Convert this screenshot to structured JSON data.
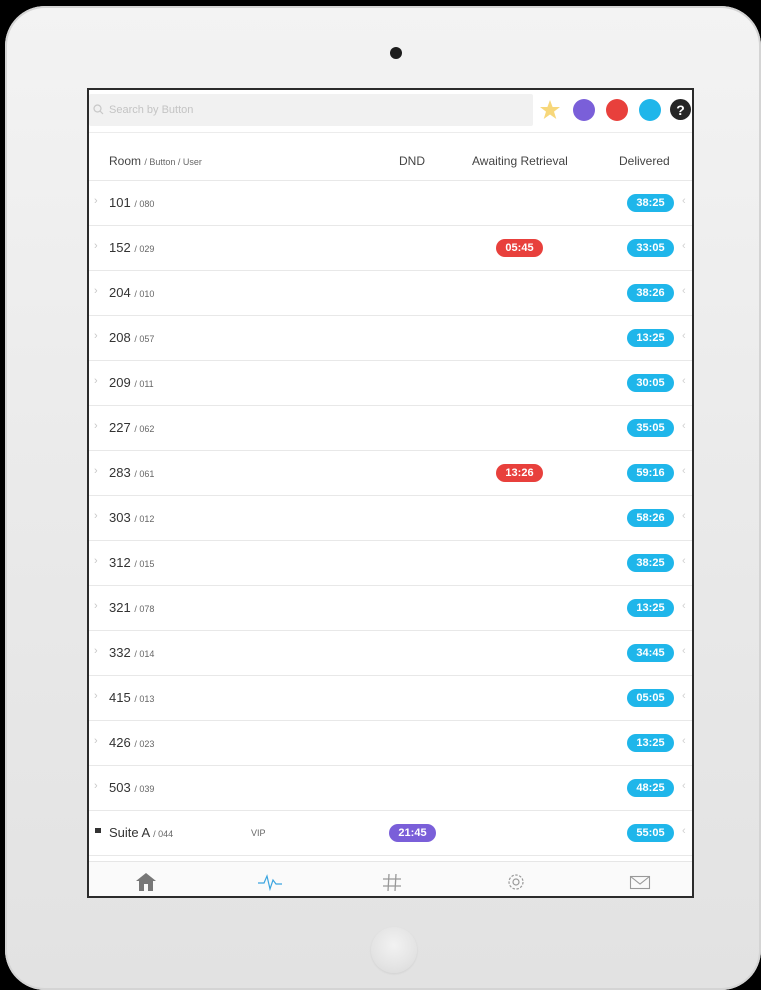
{
  "search": {
    "placeholder": "Search by Button"
  },
  "filters": {
    "colors": {
      "star": "#f7d77a",
      "purple": "#7a5fd9",
      "red": "#e8403c",
      "blue": "#1fb6ea"
    },
    "help_label": "?"
  },
  "columns": {
    "room": "Room",
    "room_sub": "/ Button / User",
    "dnd": "DND",
    "awaiting": "Awaiting Retrieval",
    "delivered": "Delivered"
  },
  "rows": [
    {
      "room": "101",
      "button": "/ 080",
      "delivered": "38:25"
    },
    {
      "room": "152",
      "button": "/ 029",
      "awaiting": "05:45",
      "delivered": "33:05"
    },
    {
      "room": "204",
      "button": "/ 010",
      "delivered": "38:26"
    },
    {
      "room": "208",
      "button": "/ 057",
      "delivered": "13:25"
    },
    {
      "room": "209",
      "button": "/ 011",
      "delivered": "30:05"
    },
    {
      "room": "227",
      "button": "/ 062",
      "delivered": "35:05"
    },
    {
      "room": "283",
      "button": "/ 061",
      "awaiting": "13:26",
      "delivered": "59:16"
    },
    {
      "room": "303",
      "button": "/ 012",
      "delivered": "58:26"
    },
    {
      "room": "312",
      "button": "/ 015",
      "delivered": "38:25"
    },
    {
      "room": "321",
      "button": "/ 078",
      "delivered": "13:25"
    },
    {
      "room": "332",
      "button": "/ 014",
      "delivered": "34:45"
    },
    {
      "room": "415",
      "button": "/ 013",
      "delivered": "05:05"
    },
    {
      "room": "426",
      "button": "/ 023",
      "delivered": "13:25"
    },
    {
      "room": "503",
      "button": "/ 039",
      "delivered": "48:25"
    },
    {
      "room": "Suite A",
      "button": "/ 044",
      "user": "VIP",
      "dnd": "21:45",
      "delivered": "55:05"
    }
  ],
  "tabbar": {
    "icons": [
      "home-icon",
      "activity-icon",
      "hashtag-icon",
      "gear-icon",
      "mail-icon"
    ]
  }
}
